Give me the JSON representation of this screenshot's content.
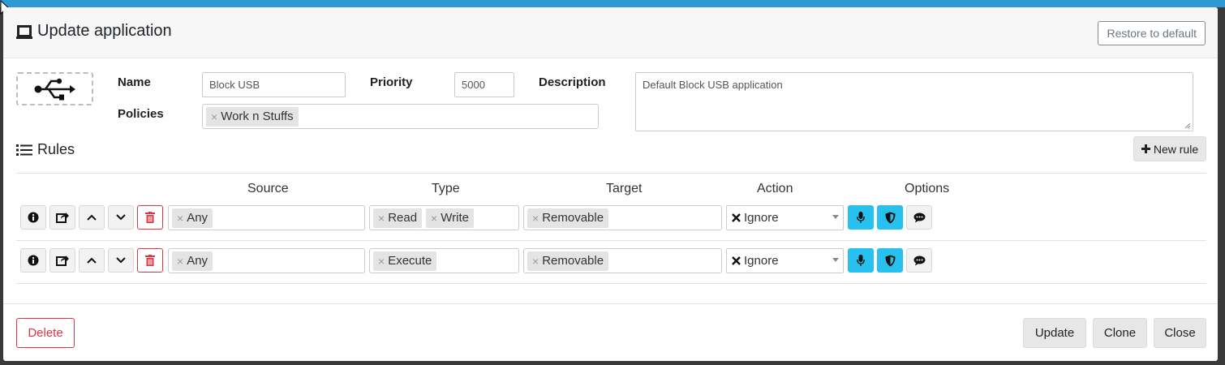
{
  "modal": {
    "title": "Update application",
    "restore_label": "Restore to default"
  },
  "form": {
    "name_label": "Name",
    "name_value": "Block USB",
    "priority_label": "Priority",
    "priority_value": "5000",
    "description_label": "Description",
    "description_value": "Default Block USB application",
    "policies_label": "Policies",
    "policies": [
      "Work n Stuffs"
    ]
  },
  "rules": {
    "title": "Rules",
    "new_rule_label": "New rule",
    "columns": {
      "source": "Source",
      "type": "Type",
      "target": "Target",
      "action": "Action",
      "options": "Options"
    },
    "rows": [
      {
        "source": [
          "Any"
        ],
        "type": [
          "Read",
          "Write"
        ],
        "target": [
          "Removable"
        ],
        "action": "Ignore"
      },
      {
        "source": [
          "Any"
        ],
        "type": [
          "Execute"
        ],
        "target": [
          "Removable"
        ],
        "action": "Ignore"
      }
    ]
  },
  "footer": {
    "delete_label": "Delete",
    "update_label": "Update",
    "clone_label": "Clone",
    "close_label": "Close"
  },
  "icons": {
    "usb": "usb-icon",
    "window": "window-icon",
    "list": "list-icon",
    "plus": "plus-icon",
    "info": "info-icon",
    "export": "share-icon",
    "up": "chevron-up-icon",
    "down": "chevron-down-icon",
    "trash": "trash-icon",
    "mic": "microphone-icon",
    "shield": "shield-icon",
    "comment": "comment-icon",
    "ignore": "x-mark-icon"
  },
  "colors": {
    "accent": "#28c0ee",
    "danger": "#dc3545",
    "topbar": "#2d9ad3"
  }
}
